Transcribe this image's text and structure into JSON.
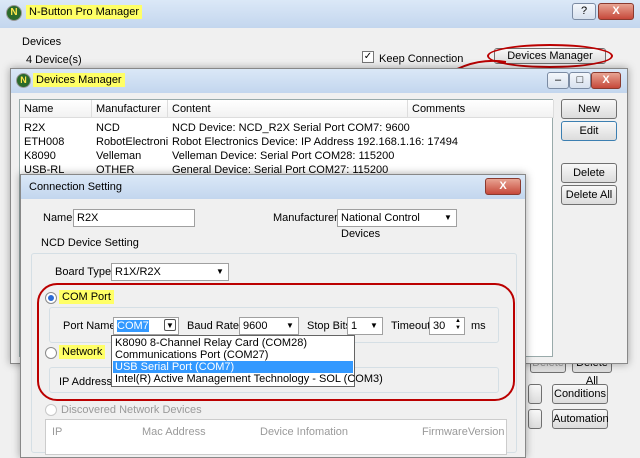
{
  "main": {
    "title": "N-Button Pro Manager",
    "devices_group": "Devices",
    "device_count": "4 Device(s)",
    "keep_connection": "Keep Connection",
    "devices_manager_btn": "Devices Manager",
    "help_btn": "?",
    "close_btn": "X",
    "btn_delete": "Delete",
    "btn_delete_all": "Delete All",
    "btn_conditions": "Conditions",
    "btn_automation": "Automation"
  },
  "devices_manager": {
    "title": "Devices Manager",
    "columns": [
      "Name",
      "Manufacturer",
      "Content",
      "Comments"
    ],
    "rows": [
      [
        "R2X",
        "NCD",
        "NCD Device: NCD_R2X  Serial Port  COM7: 9600",
        ""
      ],
      [
        "ETH008",
        "RobotElectronics",
        "Robot Electronics Device:  IP Address 192.168.1.16: 17494",
        ""
      ],
      [
        "K8090",
        "Velleman",
        "Velleman Device:   Serial Port  COM28: 115200",
        ""
      ],
      [
        "USB-RL",
        "OTHER",
        "General Device:  Serial Port  COM27: 115200",
        ""
      ]
    ],
    "btn_new": "New",
    "btn_edit": "Edit",
    "btn_delete": "Delete",
    "btn_delete_all": "Delete All",
    "minimize": "–",
    "maximize": "□",
    "close": "X"
  },
  "connection": {
    "title": "Connection Setting",
    "close": "X",
    "name_label": "Name:",
    "name_value": "R2X",
    "manufacturer_label": "Manufacturer:",
    "manufacturer_value": "National Control Devices",
    "ncd_group": "NCD Device Setting",
    "board_type_label": "Board Type:",
    "board_type_value": "R1X/R2X",
    "com_port_radio": "COM Port",
    "port_name_label": "Port Name:",
    "port_name_value": "COM7",
    "baud_label": "Baud Rate:",
    "baud_value": "9600",
    "stop_bits_label": "Stop Bits",
    "stop_bits_value": "1",
    "timeout_label": "Timeout:",
    "timeout_value": "30",
    "timeout_unit": "ms",
    "port_options": [
      "K8090 8-Channel Relay Card (COM28)",
      "Communications Port (COM27)",
      "USB Serial Port (COM7)",
      "Intel(R) Active Management Technology - SOL (COM3)"
    ],
    "network_radio": "Network",
    "ip_label": "IP Address:",
    "discovered_radio": "Discovered Network Devices",
    "disc_columns": [
      "IP",
      "Mac Address",
      "Device Infomation",
      "FirmwareVersion"
    ]
  },
  "colors": {
    "highlight": "#ffff66",
    "annotation": "#b00000",
    "selection": "#3399ff"
  }
}
